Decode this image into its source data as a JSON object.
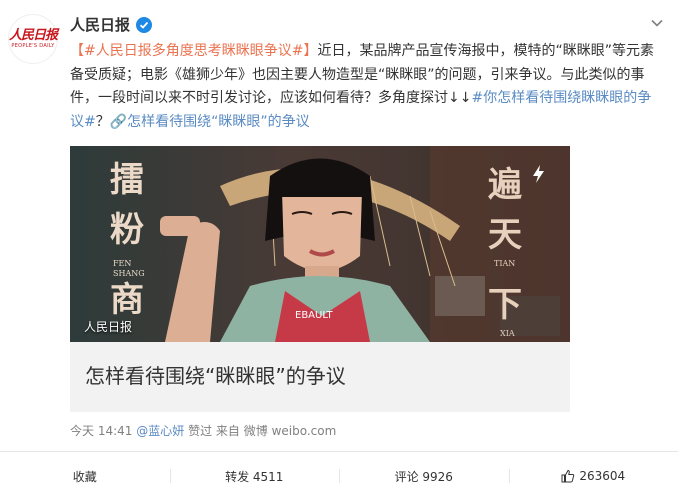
{
  "account": {
    "name": "人民日报",
    "logo_text": "人民日报",
    "logo_subtext": "PEOPLE'S DAILY"
  },
  "post": {
    "segments": [
      {
        "text": "【#人民日报多角度思考眯眯眼争议#】",
        "style": "link"
      },
      {
        "text": "近日，某品牌产品宣传海报中，模特的“眯眯眼”等元素备受质疑；电影《雄狮少年》也因主要人物造型是“眯眯眼”的问题，引来争议。与此类似的事件，一段时间以来不时引发讨论，应该如何看待？多角度探讨↓↓",
        "style": "normal"
      },
      {
        "text": "#你怎样看待围绕眯眯眼的争议#",
        "style": "blue"
      },
      {
        "text": "？",
        "style": "normal"
      },
      {
        "text": "🔗怎样看待围绕“眯眯眼”的争议",
        "style": "blue"
      }
    ]
  },
  "media": {
    "caption": "人民日报",
    "card_title": "怎样看待围绕“眯眯眼”的争议",
    "poster_left_chars": [
      "擂",
      "粉",
      "商"
    ],
    "poster_left_small": [
      "FEN",
      "SHANG"
    ],
    "poster_right_chars": [
      "遍",
      "天",
      "下"
    ],
    "poster_right_small": [
      "TIAN",
      "XIA"
    ],
    "shirt_text": "EBAULT"
  },
  "meta": {
    "time": "今天 14:41",
    "user": "@蓝心妍",
    "action": "赞过",
    "source_label": "来自",
    "source": "微博 weibo.com"
  },
  "actions": {
    "favorite": "收藏",
    "repost": "转发 4511",
    "comment": "评论 9926",
    "like": "263604"
  },
  "colors": {
    "link_orange": "#eb7350",
    "link_blue": "#5a8bc3",
    "brand_red": "#c8161d"
  }
}
